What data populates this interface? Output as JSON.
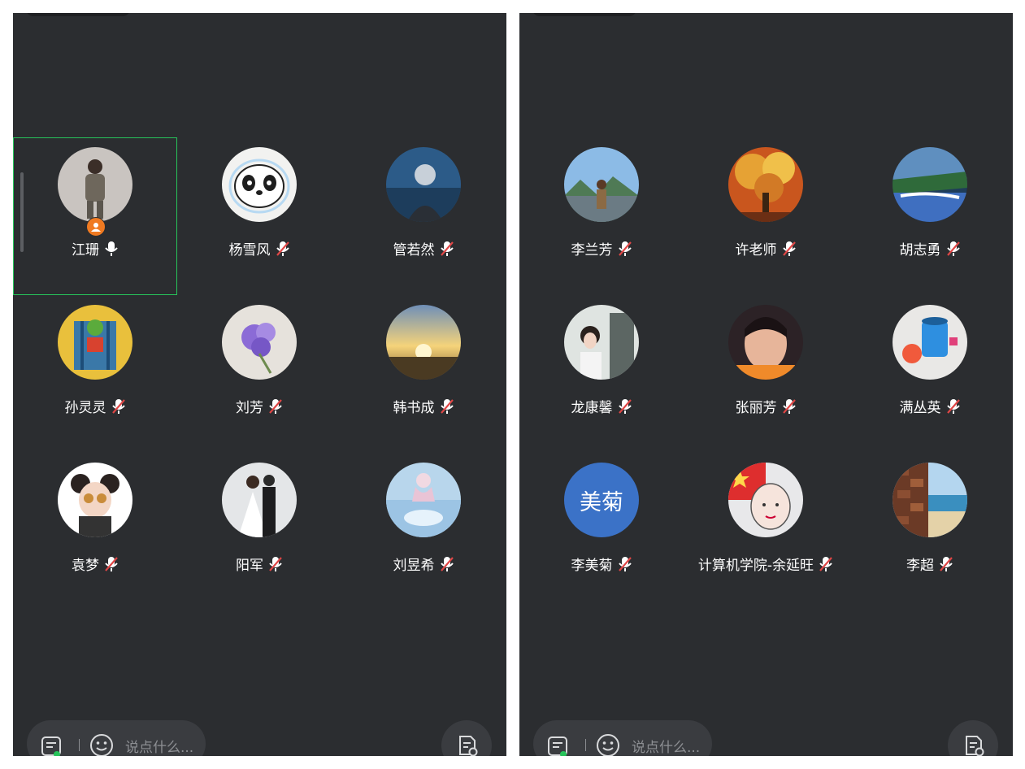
{
  "colors": {
    "panel_bg": "#2b2d30",
    "active_border": "#27c35a",
    "host_badge": "#f07a21",
    "muted_slash": "#e04646",
    "text_avatar_bg": "#3b72c7"
  },
  "chat_bar": {
    "placeholder": "说点什么..."
  },
  "panels": [
    {
      "participants": [
        {
          "name": "江珊",
          "mic": "on",
          "host": true,
          "active": true,
          "avatar": "photo-woman"
        },
        {
          "name": "杨雪风",
          "mic": "muted",
          "avatar": "panda"
        },
        {
          "name": "管若然",
          "mic": "muted",
          "avatar": "portrait-blue"
        },
        {
          "name": "孙灵灵",
          "mic": "muted",
          "avatar": "painting-frog"
        },
        {
          "name": "刘芳",
          "mic": "muted",
          "avatar": "purple-flower"
        },
        {
          "name": "韩书成",
          "mic": "muted",
          "avatar": "sunset"
        },
        {
          "name": "袁梦",
          "mic": "muted",
          "avatar": "cartoon-girl"
        },
        {
          "name": "阳军",
          "mic": "muted",
          "avatar": "wedding"
        },
        {
          "name": "刘昱希",
          "mic": "muted",
          "avatar": "anime-horse"
        }
      ]
    },
    {
      "participants": [
        {
          "name": "李兰芳",
          "mic": "muted",
          "avatar": "mountain-view"
        },
        {
          "name": "许老师",
          "mic": "muted",
          "avatar": "autumn-tree"
        },
        {
          "name": "胡志勇",
          "mic": "muted",
          "avatar": "waterfall"
        },
        {
          "name": "龙康馨",
          "mic": "muted",
          "avatar": "woman-office"
        },
        {
          "name": "张丽芳",
          "mic": "muted",
          "avatar": "woman-face"
        },
        {
          "name": "满丛英",
          "mic": "muted",
          "avatar": "blue-cup"
        },
        {
          "name": "李美菊",
          "mic": "muted",
          "avatar": "text",
          "avatar_text": "美菊"
        },
        {
          "name": "计算机学院-余延旺",
          "mic": "muted",
          "avatar": "flag-cartoon"
        },
        {
          "name": "李超",
          "mic": "muted",
          "avatar": "beach-rocks"
        }
      ]
    }
  ]
}
